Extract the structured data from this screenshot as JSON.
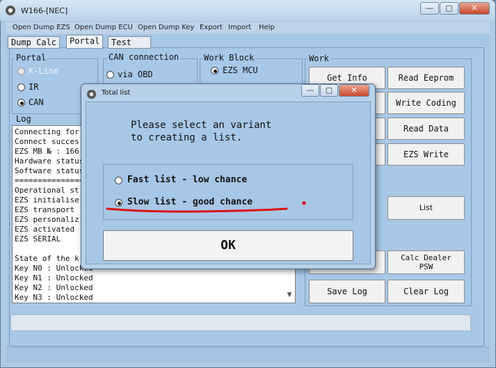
{
  "window": {
    "title": "W166-[NEC]",
    "controls": {
      "minimize": "—",
      "maximize": "▢",
      "close": "✕"
    }
  },
  "menu": [
    "Open Dump EZS",
    "Open Dump ECU",
    "Open Dump Key",
    "Export",
    "Import",
    "Help"
  ],
  "tabs": [
    "Dump Calc",
    "Portal",
    "Test"
  ],
  "portal": {
    "label": "Portal",
    "options": [
      "K-Line",
      "IR",
      "CAN"
    ],
    "selected": "CAN"
  },
  "can_connection": {
    "label": "CAN connection",
    "option": "via OBD"
  },
  "work_block": {
    "label": "Work Block",
    "option": "EZS MCU"
  },
  "work": {
    "label": "Work",
    "buttons": {
      "get_info": "Get Info",
      "read_eeprom": "Read Eeprom",
      "write_coding": "Write Coding",
      "read_data": "Read Data",
      "ezs_write": "EZS Write",
      "list": "List",
      "calc_dealer_psw_line1": "Calc Dealer",
      "calc_dealer_psw_line2": "PSW",
      "save_log": "Save Log",
      "clear_log": "Clear Log"
    }
  },
  "log": {
    "label": "Log",
    "lines": [
      "Connecting for",
      "Connect succes",
      "EZS MB № : 166",
      "Hardware status",
      "Software status",
      "===============",
      "Operational st",
      "EZS initialise",
      "EZS transport",
      "EZS personaliz",
      "EZS activated",
      "EZS SERIAL",
      "",
      "State of the k",
      "Key N0 : Unlocked",
      "Key N1 : Unlocked",
      "Key N2 : Unlocked",
      "Key N3 : Unlocked"
    ]
  },
  "dialog": {
    "title": "Total list",
    "message_line1": "Please select an variant",
    "message_line2": "to creating a list.",
    "options": [
      "Fast list - low chance",
      "Slow list - good chance"
    ],
    "selected": "Slow list - good chance",
    "ok_label": "OK",
    "annotation_color": "#e01010"
  }
}
